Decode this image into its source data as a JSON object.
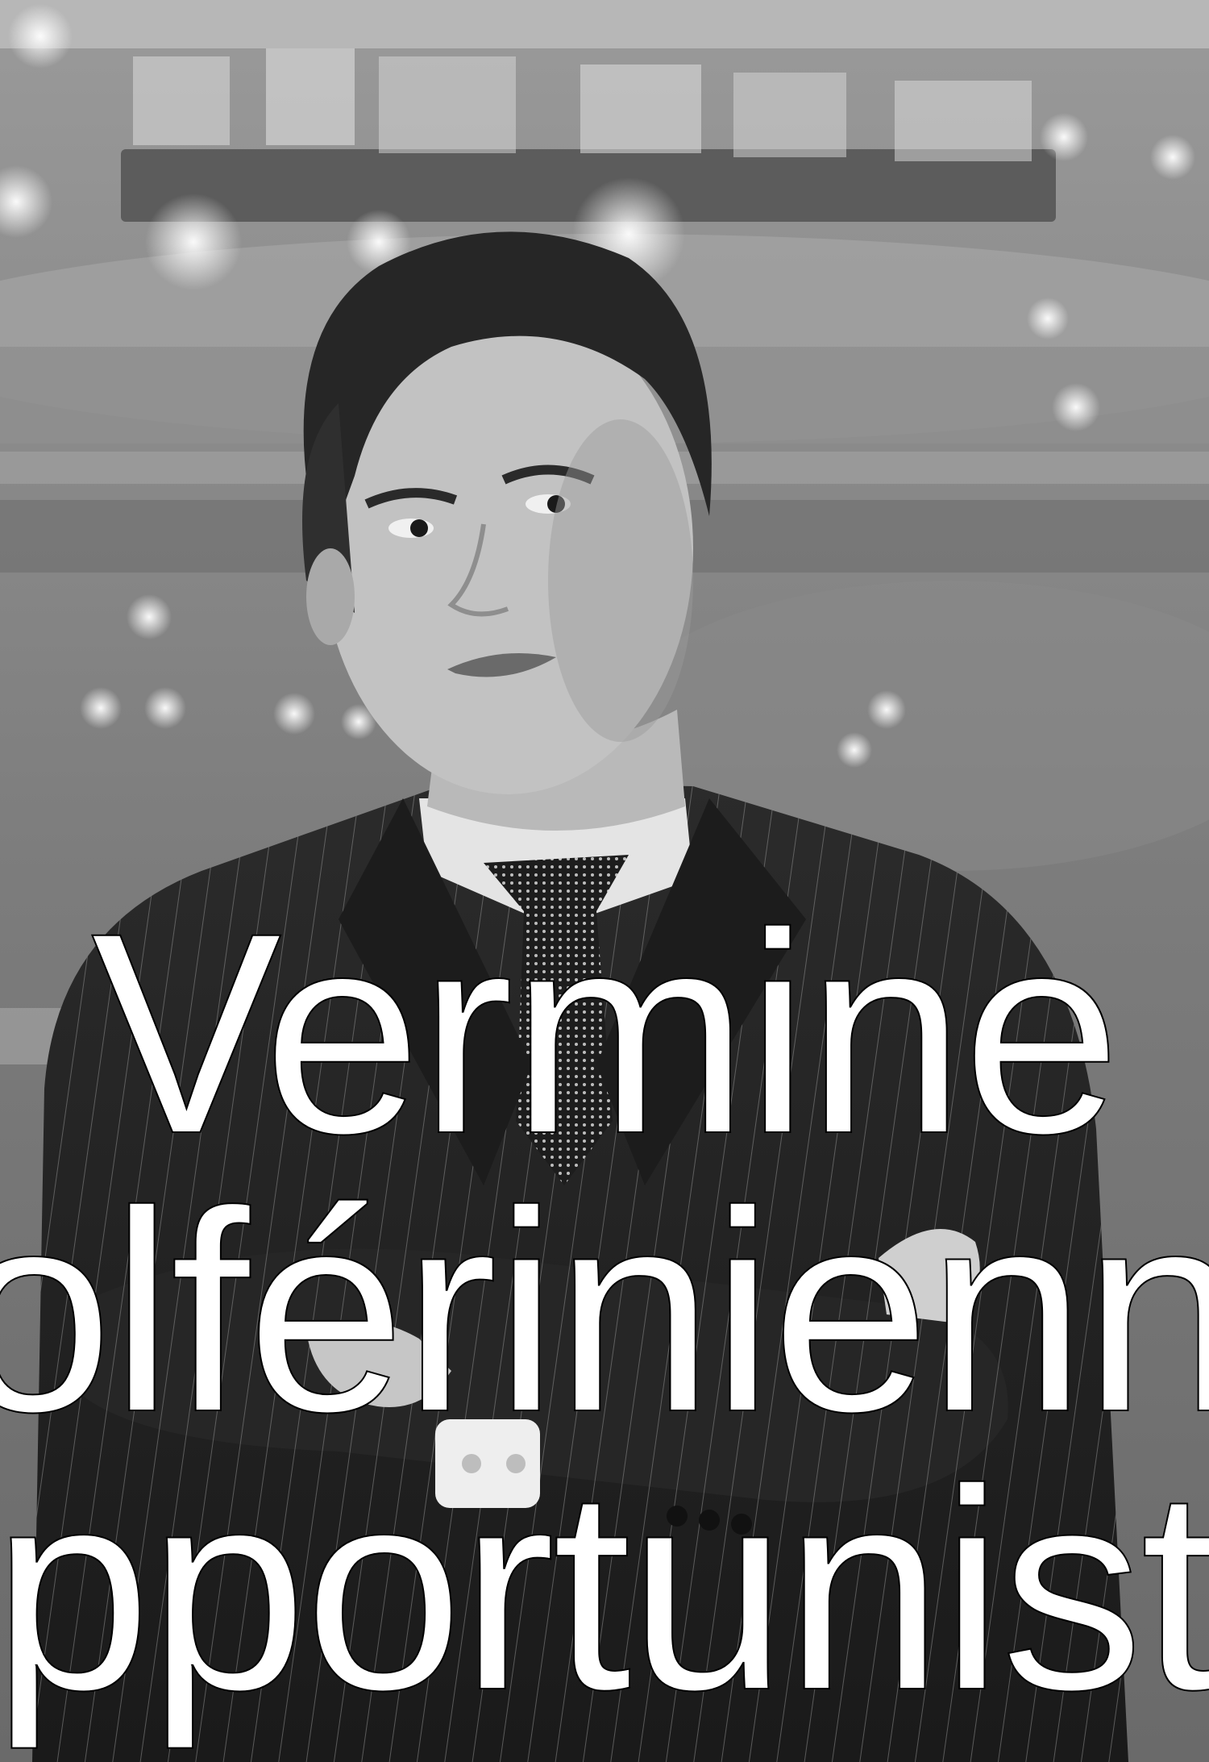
{
  "headline": {
    "line1": "Vermine",
    "line2": "solférinienne",
    "line3": "opportuniste"
  },
  "colors": {
    "text_fill": "#ffffff",
    "text_outline": "#000000"
  }
}
